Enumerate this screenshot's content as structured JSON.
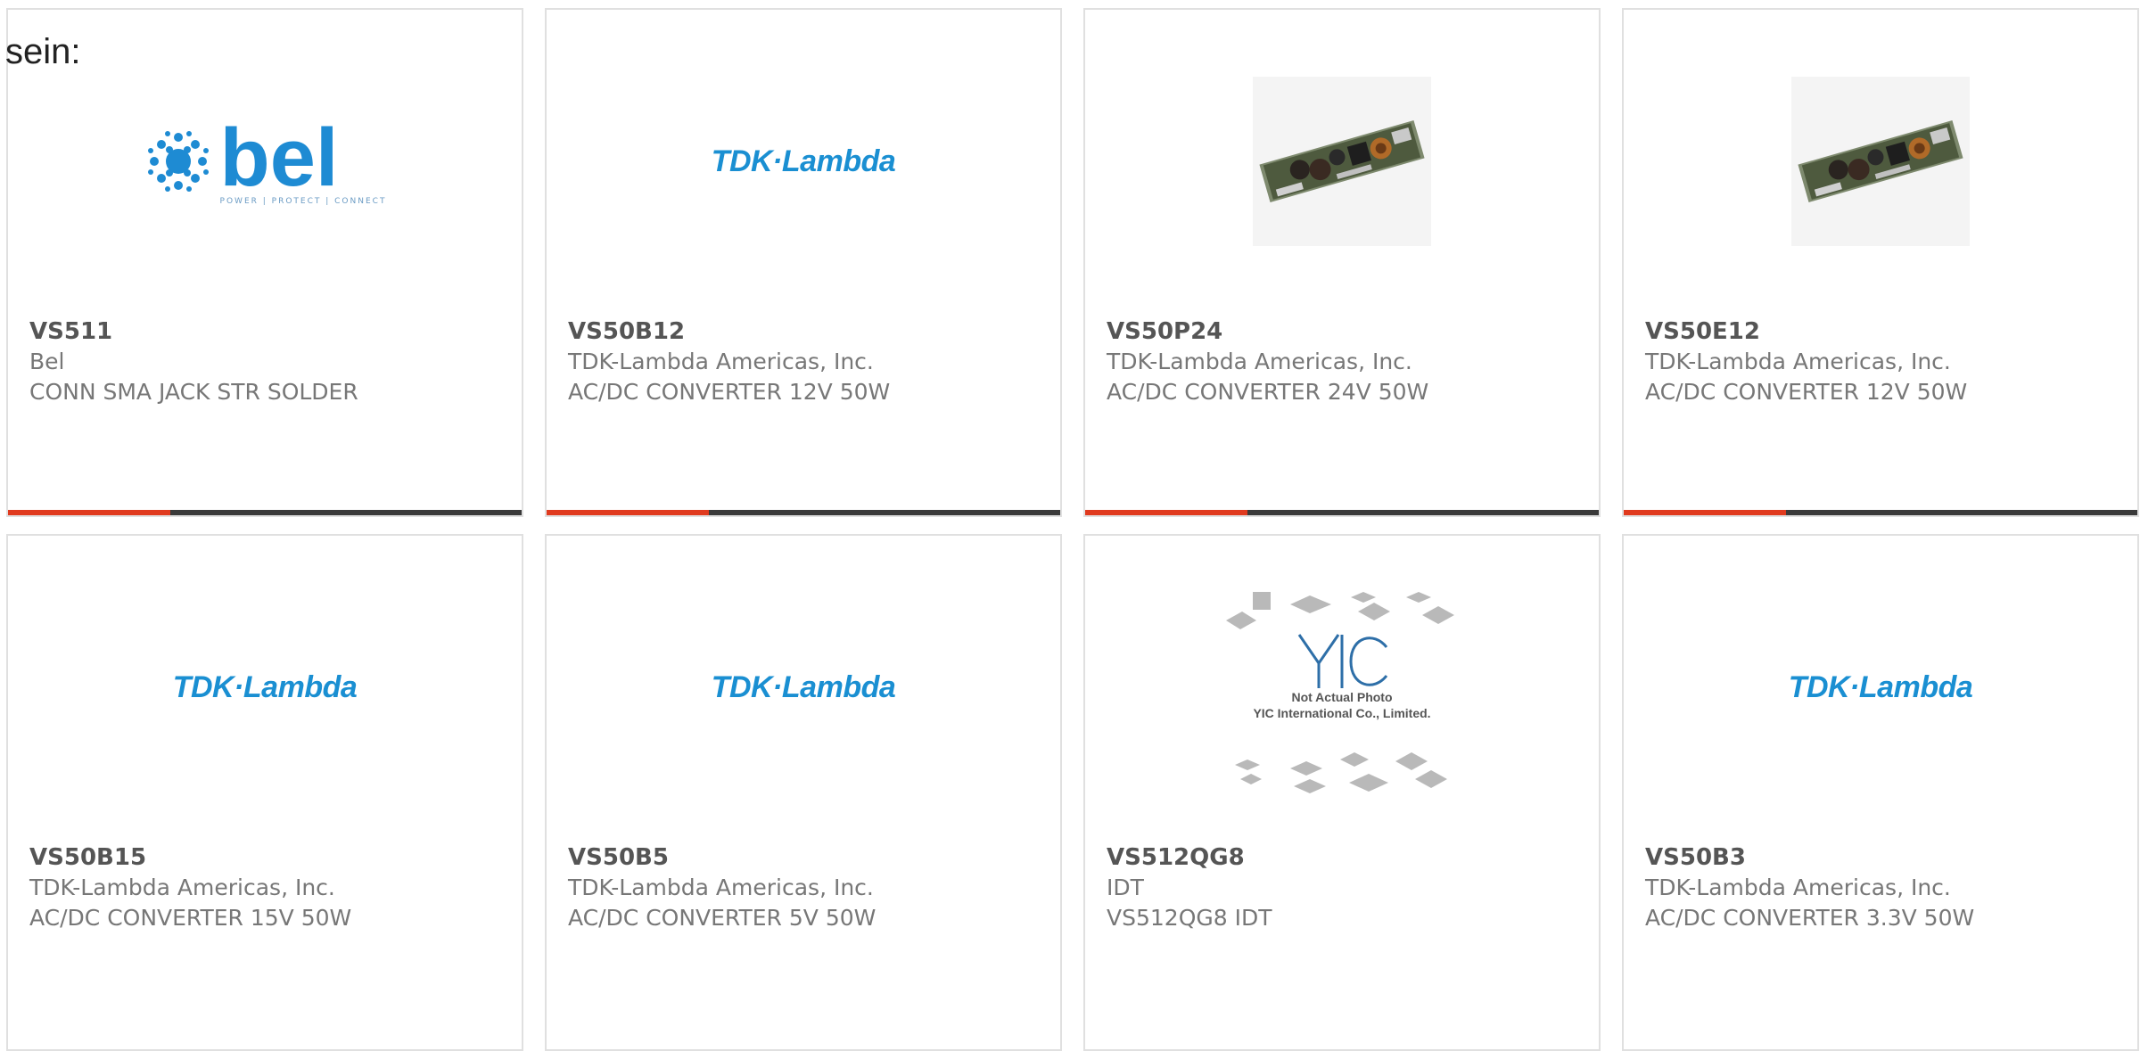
{
  "intro_text": "sein:",
  "colors": {
    "accent": "#e03a1e",
    "bar": "#3a3a3a",
    "tdk_blue": "#1a8fd2",
    "bel_blue": "#1e8bd3"
  },
  "products": [
    {
      "part": "VS511",
      "maker": "Bel",
      "desc": "CONN SMA JACK STR SOLDER",
      "image": "bel-logo",
      "logo_text": "bel",
      "logo_tagline": "POWER | PROTECT | CONNECT"
    },
    {
      "part": "VS50B12",
      "maker": "TDK-Lambda Americas, Inc.",
      "desc": "AC/DC CONVERTER 12V 50W",
      "image": "tdk-lambda-logo",
      "logo_text": "TDK·Lambda"
    },
    {
      "part": "VS50P24",
      "maker": "TDK-Lambda Americas, Inc.",
      "desc": "AC/DC CONVERTER 24V 50W",
      "image": "power-supply-photo"
    },
    {
      "part": "VS50E12",
      "maker": "TDK-Lambda Americas, Inc.",
      "desc": "AC/DC CONVERTER 12V 50W",
      "image": "power-supply-photo"
    },
    {
      "part": "VS50B15",
      "maker": "TDK-Lambda Americas, Inc.",
      "desc": "AC/DC CONVERTER 15V 50W",
      "image": "tdk-lambda-logo",
      "logo_text": "TDK·Lambda"
    },
    {
      "part": "VS50B5",
      "maker": "TDK-Lambda Americas, Inc.",
      "desc": "AC/DC CONVERTER 5V 50W",
      "image": "tdk-lambda-logo",
      "logo_text": "TDK·Lambda"
    },
    {
      "part": "VS512QG8",
      "maker": "IDT",
      "desc": "VS512QG8 IDT",
      "image": "yic-placeholder",
      "logo_text": "YIC",
      "notice_line1": "Not Actual Photo",
      "notice_line2": "YIC International Co., Limited."
    },
    {
      "part": "VS50B3",
      "maker": "TDK-Lambda Americas, Inc.",
      "desc": "AC/DC CONVERTER 3.3V 50W",
      "image": "tdk-lambda-logo",
      "logo_text": "TDK·Lambda"
    }
  ]
}
